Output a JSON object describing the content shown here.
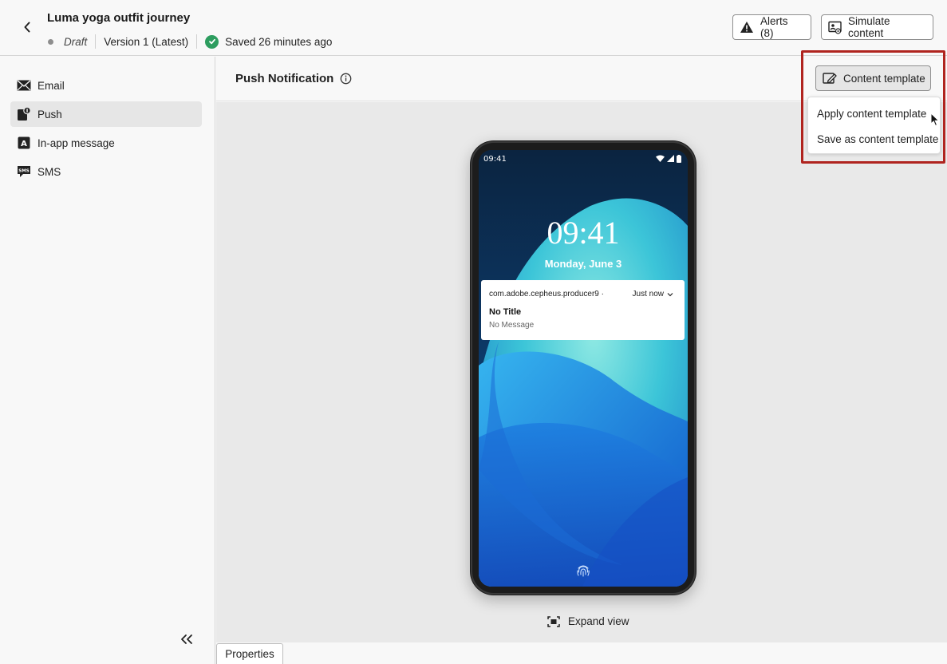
{
  "header": {
    "title": "Luma yoga outfit journey",
    "status": "Draft",
    "version": "Version 1 (Latest)",
    "saved": "Saved 26 minutes ago",
    "alerts_label": "Alerts (8)",
    "simulate_label": "Simulate content"
  },
  "sidebar": {
    "items": [
      {
        "label": "Email",
        "icon": "mail-icon"
      },
      {
        "label": "Push",
        "icon": "push-icon"
      },
      {
        "label": "In-app message",
        "icon": "in-app-icon"
      },
      {
        "label": "SMS",
        "icon": "sms-icon"
      }
    ],
    "active": "Push"
  },
  "main": {
    "title": "Push Notification",
    "content_template_label": "Content template",
    "menu": {
      "items": [
        "Apply content template",
        "Save as content template"
      ]
    },
    "expand_label": "Expand view",
    "properties_label": "Properties"
  },
  "phone": {
    "status_time": "09:41",
    "lock_time": "09:41",
    "date": "Monday, June 3",
    "notification": {
      "app": "com.adobe.cepheus.producer9 ·",
      "when": "Just now",
      "title": "No Title",
      "message": "No Message"
    }
  },
  "colors": {
    "accent_highlight": "#b0241f",
    "saved_check": "#2d9d5f",
    "screen_dark": "#0d2a4b"
  }
}
